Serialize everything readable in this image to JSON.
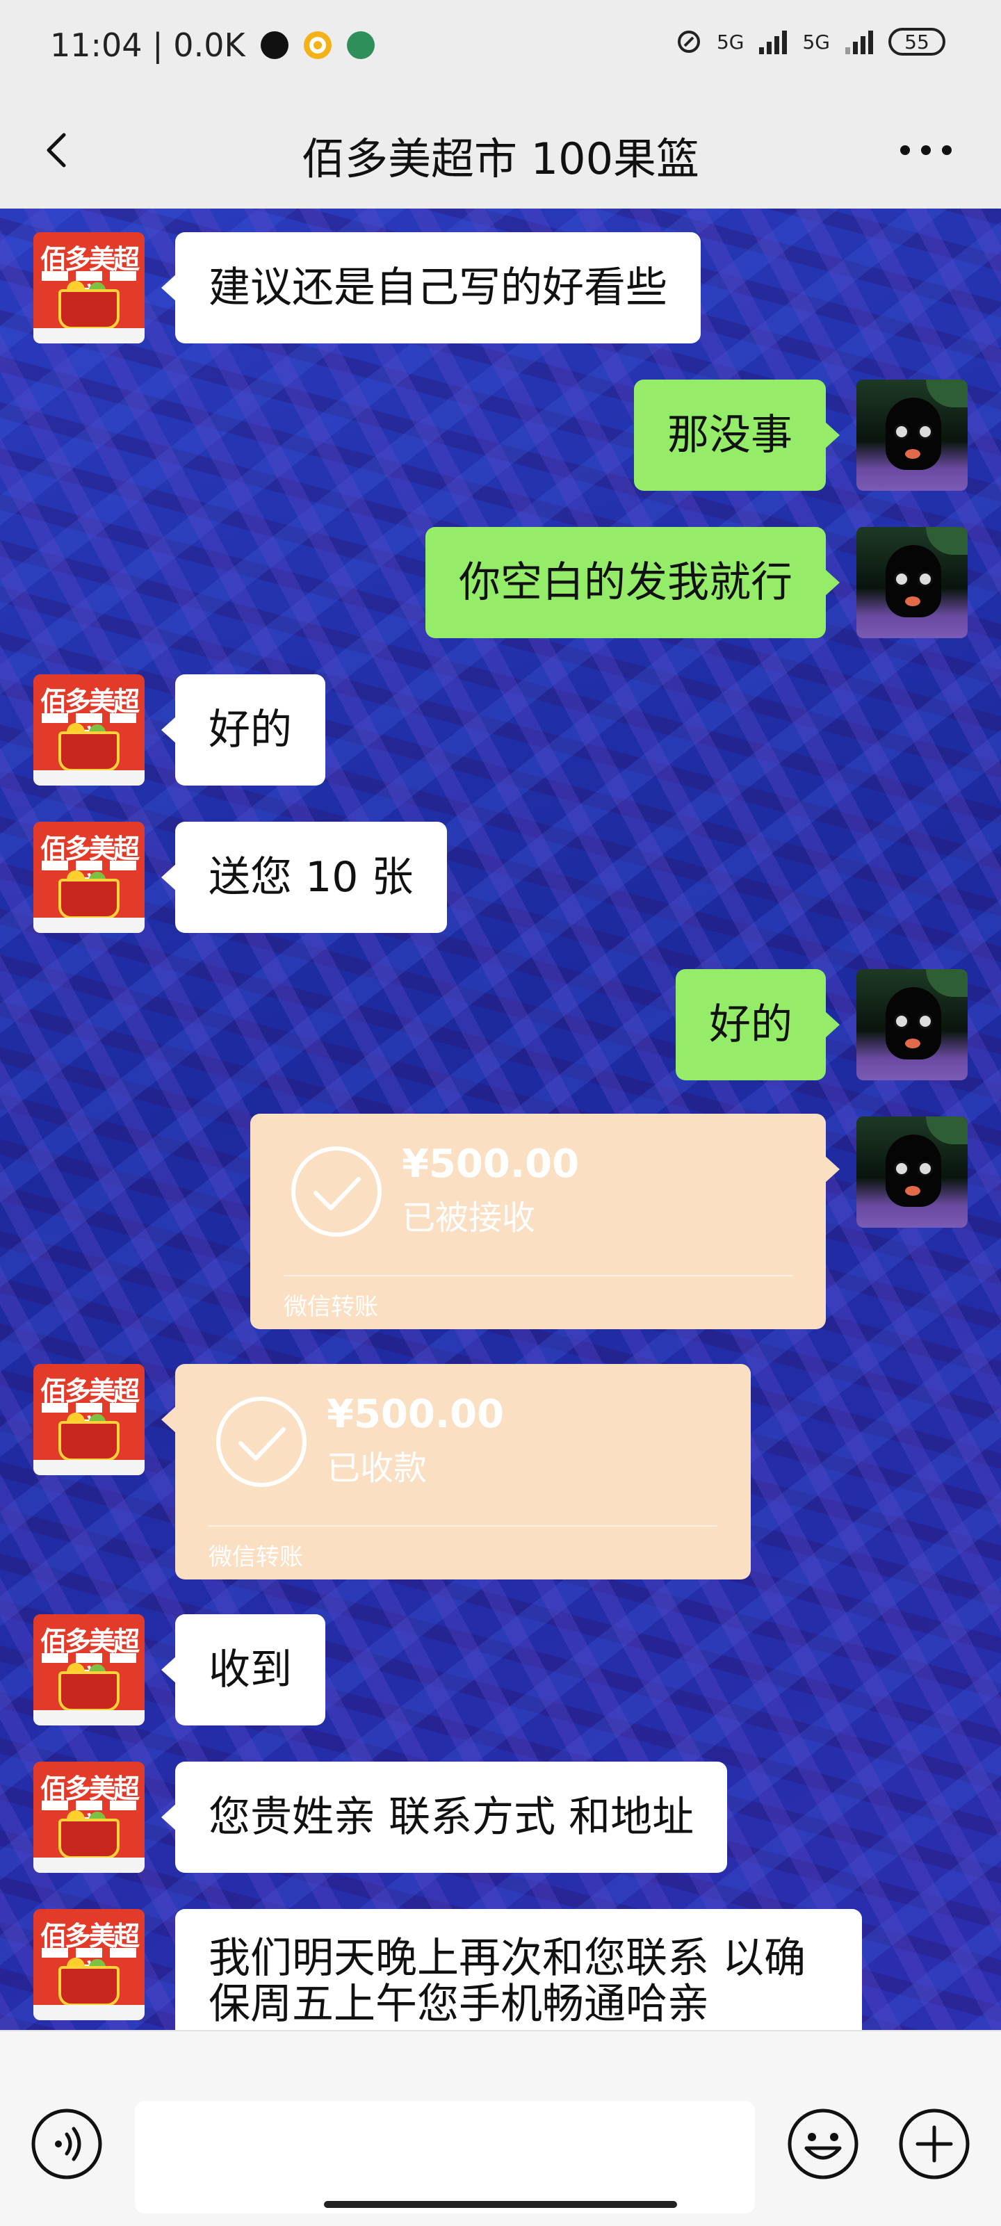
{
  "status_bar": {
    "time_speed": "11:04 | 0.0K",
    "signal_1": "5G",
    "signal_2": "5G",
    "battery": "55"
  },
  "header": {
    "title": "佰多美超市 100果篮"
  },
  "contact": {
    "avatar_title": "佰多美超市"
  },
  "messages": [
    {
      "side": "left",
      "text": "建议还是自己写的好看些"
    },
    {
      "side": "right",
      "text": "那没事"
    },
    {
      "side": "right",
      "text": "你空白的发我就行"
    },
    {
      "side": "left",
      "text": "好的"
    },
    {
      "side": "left",
      "text": "送您 10 张"
    },
    {
      "side": "right",
      "text": "好的"
    },
    {
      "side": "right",
      "type": "transfer",
      "amount": "¥500.00",
      "status": "已被接收",
      "label": "微信转账"
    },
    {
      "side": "left",
      "type": "transfer",
      "amount": "¥500.00",
      "status": "已收款",
      "label": "微信转账"
    },
    {
      "side": "left",
      "text": "收到"
    },
    {
      "side": "left",
      "text": "您贵姓亲 联系方式 和地址"
    },
    {
      "side": "left",
      "text": "我们明天晚上再次和您联系 以确保周五上午您手机畅通哈亲"
    }
  ],
  "input_bar": {
    "value": ""
  },
  "colors": {
    "sent_bubble": "#95ec69",
    "received_bubble": "#ffffff",
    "transfer_card": "#fbdfc2",
    "bar_bg": "#ededed"
  },
  "icons": [
    "back-arrow-icon",
    "more-icon",
    "voice-icon",
    "emoji-icon",
    "plus-icon",
    "check-icon"
  ]
}
